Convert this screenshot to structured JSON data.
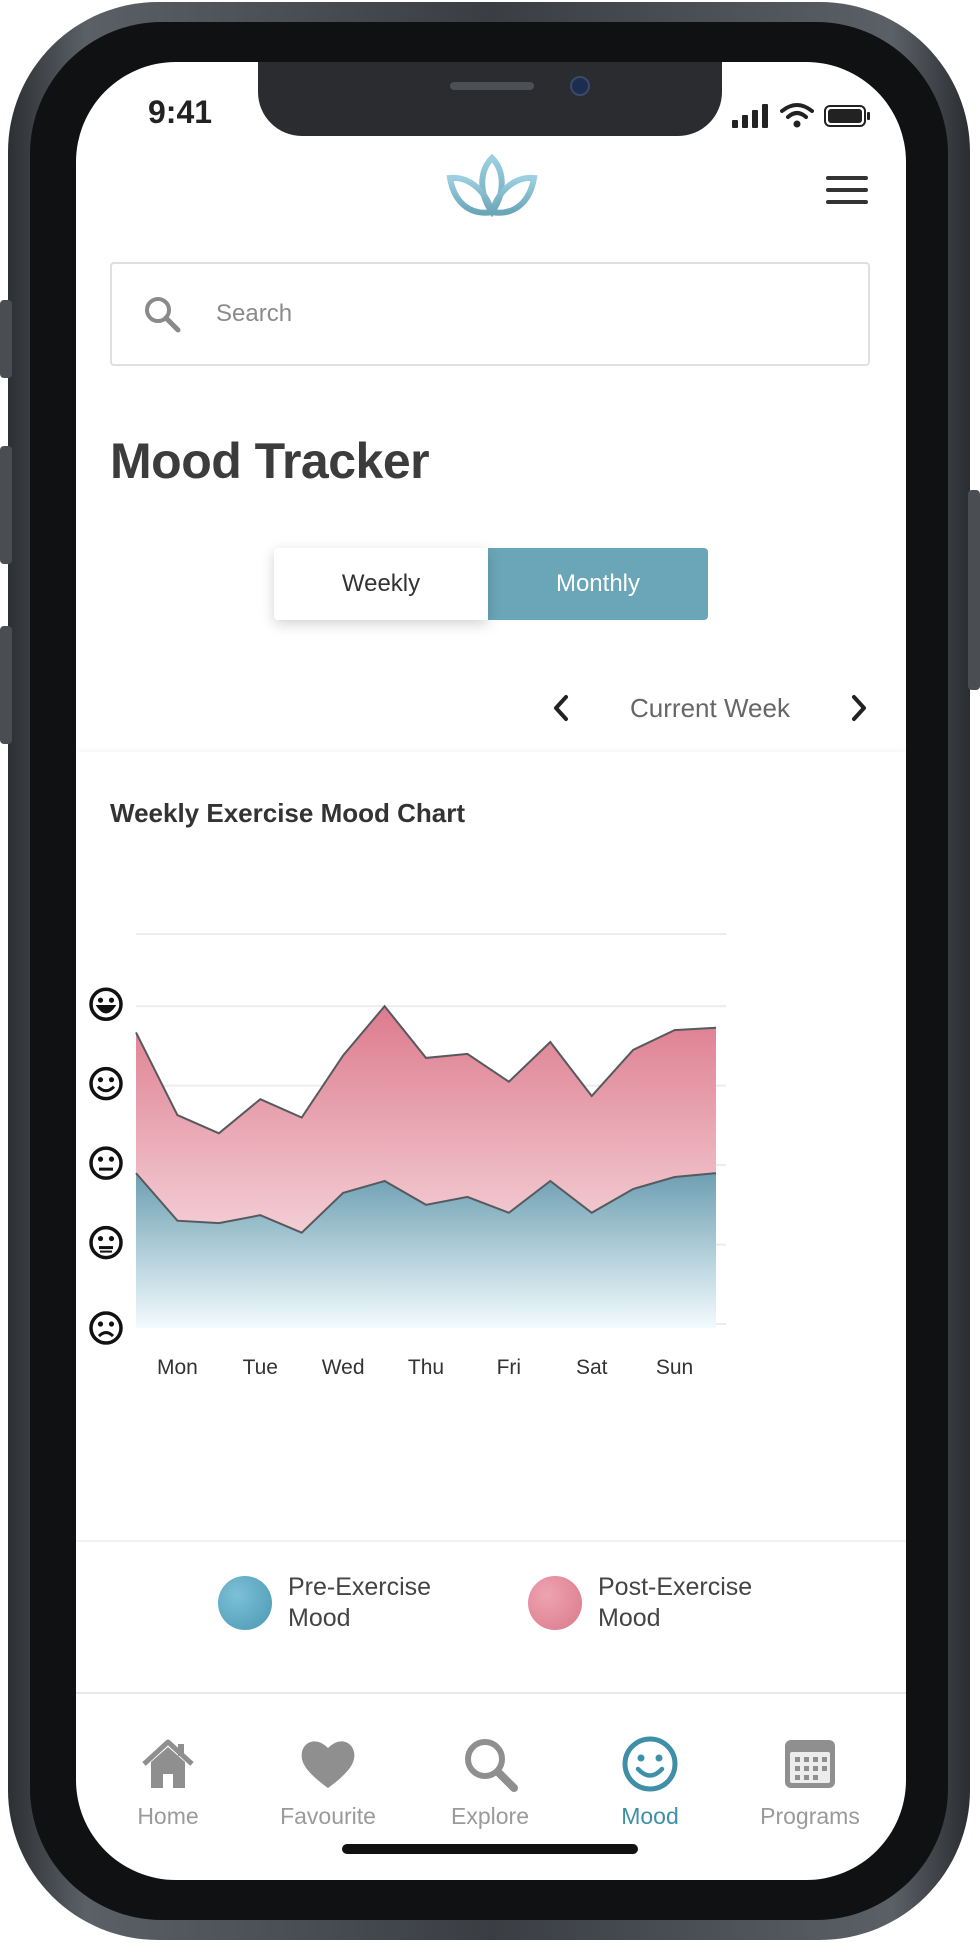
{
  "status_bar": {
    "time": "9:41"
  },
  "search": {
    "placeholder": "Search"
  },
  "page_title": "Mood Tracker",
  "toggle": {
    "weekly_label": "Weekly",
    "monthly_label": "Monthly",
    "selected": "Monthly"
  },
  "week_nav": {
    "label": "Current Week"
  },
  "colors": {
    "accent": "#3e8fa8",
    "pre": "#5aa6c0",
    "post": "#e08a98",
    "toggle_active": "#6aa6b8"
  },
  "chart_data": {
    "type": "area",
    "title": "Weekly Exercise Mood Chart",
    "categories": [
      "Mon",
      "Tue",
      "Wed",
      "Thu",
      "Fri",
      "Sat",
      "Sun"
    ],
    "y_scale": [
      "very-sad-face",
      "sad-face",
      "neutral-face",
      "happy-face",
      "very-happy-face"
    ],
    "ylim": [
      1,
      5
    ],
    "grid": true,
    "series": [
      {
        "name": "Pre-Exercise Mood",
        "x": [
          0,
          0.5,
          1,
          1.5,
          2,
          2.5,
          3,
          3.5,
          4,
          4.5,
          5,
          5.5,
          6,
          6.5,
          7
        ],
        "values": [
          2.95,
          2.35,
          2.32,
          2.42,
          2.2,
          2.7,
          2.85,
          2.55,
          2.65,
          2.45,
          2.85,
          2.45,
          2.75,
          2.9,
          2.95
        ]
      },
      {
        "name": "Post-Exercise Mood",
        "x": [
          0,
          0.5,
          1,
          1.5,
          2,
          2.5,
          3,
          3.5,
          4,
          4.5,
          5,
          5.5,
          6,
          6.5,
          7
        ],
        "values": [
          4.72,
          3.68,
          3.45,
          3.88,
          3.65,
          4.43,
          5.05,
          4.4,
          4.45,
          4.1,
          4.6,
          3.92,
          4.5,
          4.75,
          4.78
        ]
      }
    ]
  },
  "legend": {
    "pre_label": "Pre-Exercise Mood",
    "post_label": "Post-Exercise Mood"
  },
  "tabs": [
    {
      "label": "Home",
      "icon": "home-icon",
      "active": false
    },
    {
      "label": "Favourite",
      "icon": "heart-icon",
      "active": false
    },
    {
      "label": "Explore",
      "icon": "search-icon",
      "active": false
    },
    {
      "label": "Mood",
      "icon": "smiley-icon",
      "active": true
    },
    {
      "label": "Programs",
      "icon": "calendar-icon",
      "active": false
    }
  ]
}
